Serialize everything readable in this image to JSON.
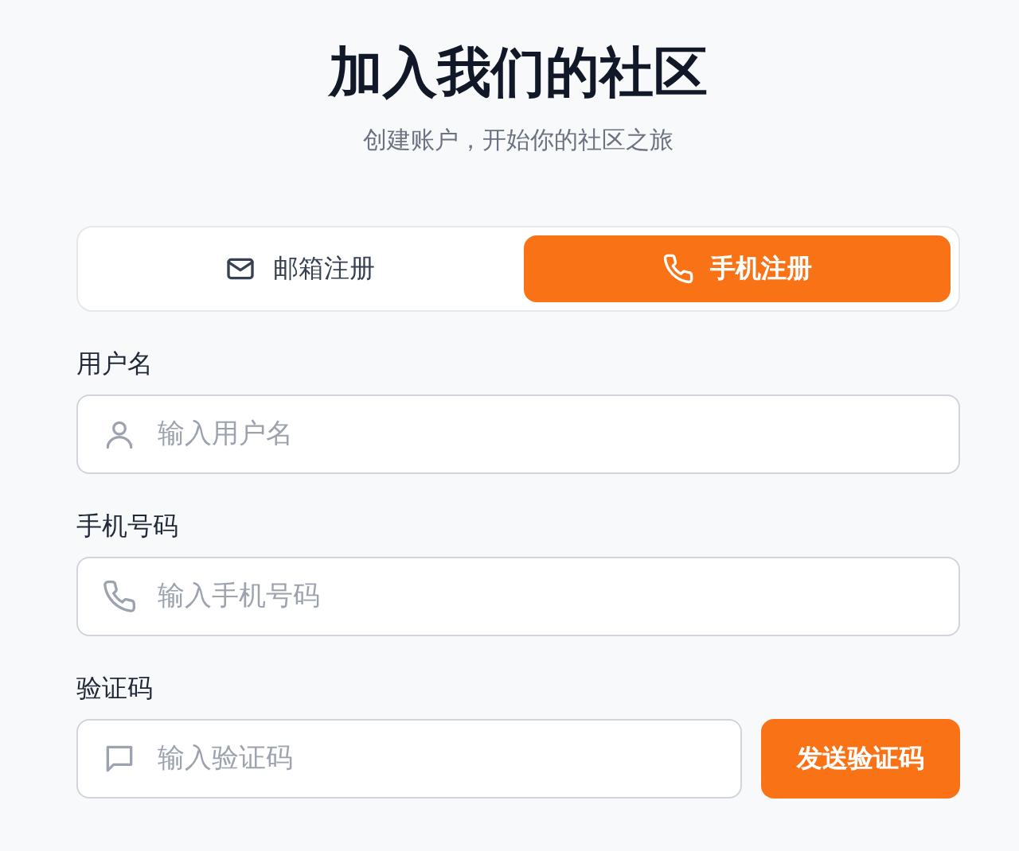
{
  "title": "加入我们的社区",
  "subtitle": "创建账户，开始你的社区之旅",
  "tabs": [
    {
      "label": "邮箱注册",
      "kind": "mail",
      "selected": false
    },
    {
      "label": "手机注册",
      "kind": "phone",
      "selected": true
    }
  ],
  "fields": [
    {
      "label": "用户名",
      "kind": "user",
      "placeholder": "输入用户名"
    },
    {
      "label": "手机号码",
      "kind": "phone",
      "placeholder": "输入手机号码"
    },
    {
      "label": "验证码",
      "kind": "message",
      "placeholder": "输入验证码",
      "button": "发送验证码"
    }
  ]
}
